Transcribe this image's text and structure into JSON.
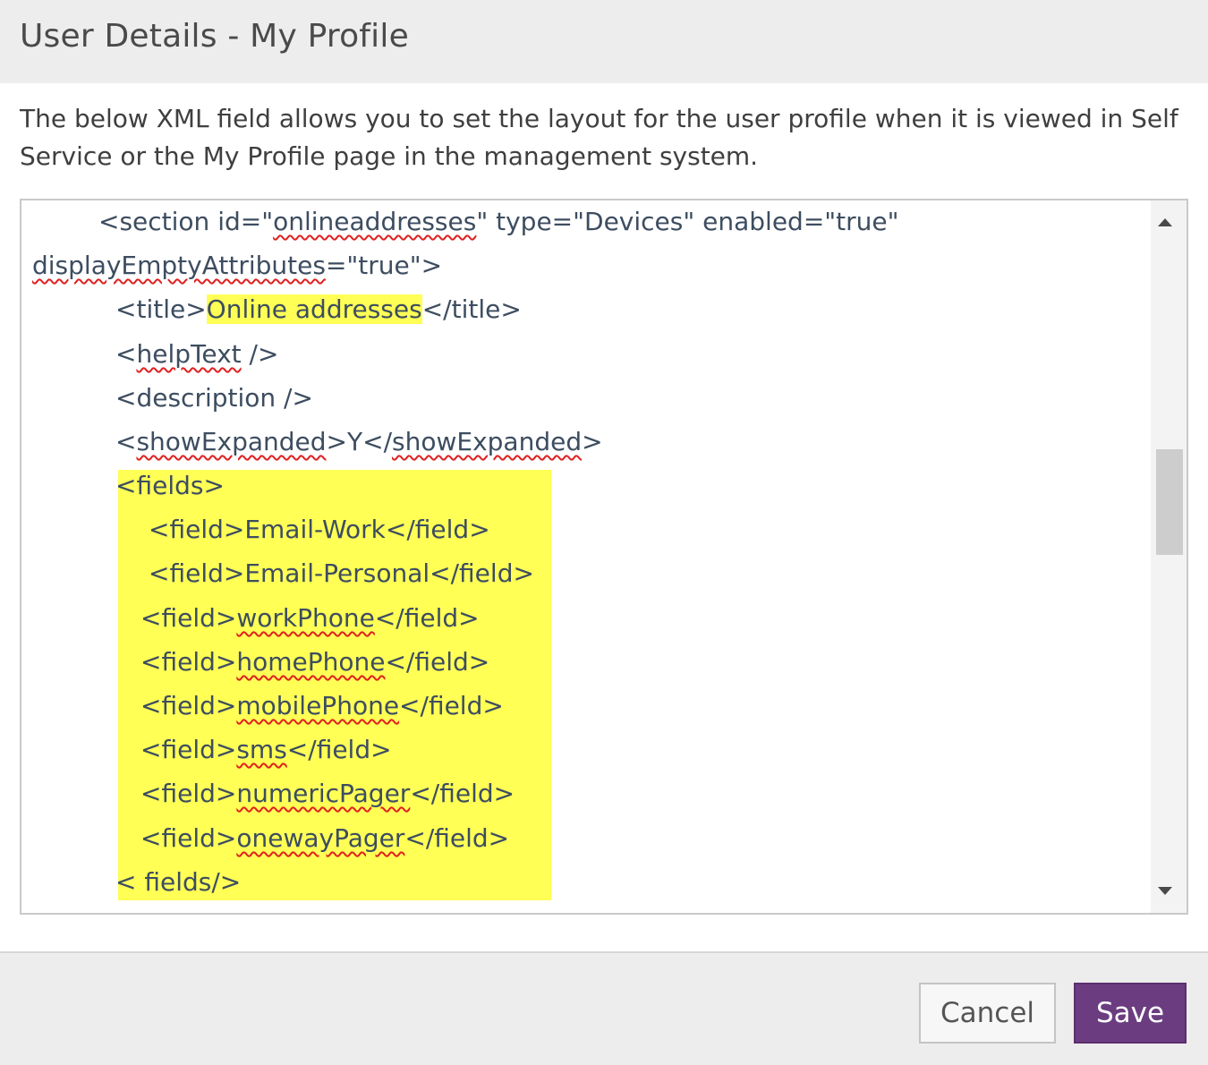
{
  "header": {
    "title": "User Details - My Profile"
  },
  "intro": "The below XML field allows you to set the layout for the user profile when it is viewed in Self Service or the My Profile page in the management system.",
  "editor": {
    "lines": {
      "l1": {
        "a": "<section id=\"",
        "b": "onlineaddresses",
        "c": "\" type=\"Devices\" enabled=\"true\""
      },
      "l2": {
        "a": "displayEmptyAttributes",
        "b": "=\"true\">"
      },
      "l3": {
        "a": "<title>",
        "b": "Online addresses",
        "c": "</title>"
      },
      "l4": {
        "a": "<",
        "b": "helpText",
        "c": " />"
      },
      "l5": {
        "a": "<description />"
      },
      "l6": {
        "a": "<",
        "b": "showExpanded",
        "c": ">Y</",
        "d": "showExpanded",
        "e": ">"
      },
      "l7": {
        "a": "<fields>"
      },
      "l8": {
        "a": "<field>Email-Work</field>"
      },
      "l9": {
        "a": "<field>Email-Personal</field>"
      },
      "l10": {
        "a": "<field>",
        "b": "workPhone",
        "c": "</field>"
      },
      "l11": {
        "a": "<field>",
        "b": "homePhone",
        "c": "</field>"
      },
      "l12": {
        "a": "<field>",
        "b": "mobilePhone",
        "c": "</field>"
      },
      "l13": {
        "a": "<field>",
        "b": "sms",
        "c": "</field>"
      },
      "l14": {
        "a": "<field>",
        "b": "numericPager",
        "c": "</field>"
      },
      "l15": {
        "a": "<field>",
        "b": "onewayPager",
        "c": "</field>"
      },
      "l16": {
        "a": "< fields/>"
      }
    },
    "highlight_color": "#ffff55",
    "spellcheck_color": "#e02020"
  },
  "scrollbar": {
    "up_icon": "triangle-up",
    "down_icon": "triangle-down"
  },
  "footer": {
    "cancel_label": "Cancel",
    "save_label": "Save"
  },
  "colors": {
    "header_bg": "#ededed",
    "save_button": "#6b3d80",
    "code_text": "#3d4d60"
  }
}
